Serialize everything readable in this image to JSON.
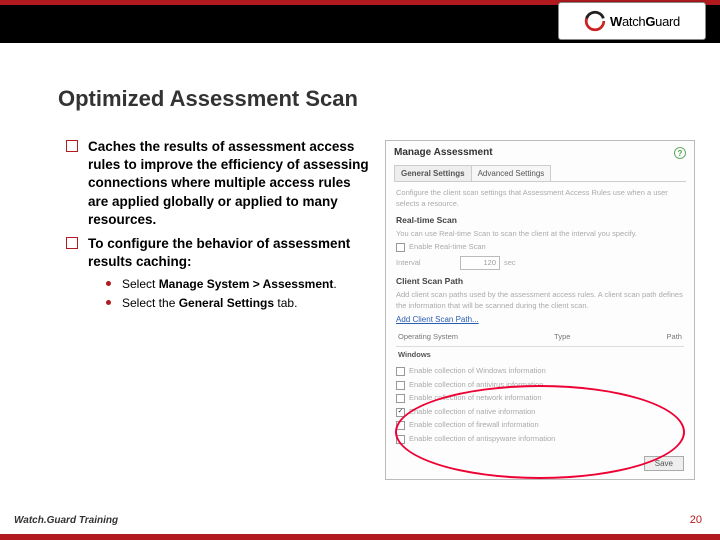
{
  "brand": {
    "name_w": "W",
    "name_atch": "atch",
    "name_g": "G",
    "name_uard": "uard"
  },
  "title": "Optimized Assessment Scan",
  "bullets": [
    "Caches the results of assessment access rules to improve the efficiency of assessing connections where multiple access rules are applied globally or applied to many resources.",
    "To configure the behavior of assessment results caching:"
  ],
  "sub": {
    "s1_pre": "Select ",
    "s1_b1": "Manage System > Assessment",
    "s1_post": ".",
    "s2_pre": "Select the ",
    "s2_b1": "General Settings",
    "s2_post": " tab."
  },
  "shot": {
    "header": "Manage Assessment",
    "tab1": "General Settings",
    "tab2": "Advanced Settings",
    "intro": "Configure the client scan settings that Assessment Access Rules use when a user selects a resource.",
    "rt_h": "Real-time Scan",
    "rt_txt": "You can use Real-time Scan to scan the client at the interval you specify.",
    "rt_cb": "Enable Real-time Scan",
    "rt_interval": "Interval",
    "rt_val": "120",
    "rt_unit": "sec",
    "csp_h": "Client Scan Path",
    "csp_txt": "Add client scan paths used by the assessment access rules. A client scan path defines the information that will be scanned during the client scan.",
    "csp_link": "Add Client Scan Path...",
    "th_os": "Operating System",
    "th_type": "Type",
    "th_path": "Path",
    "os_win": "Windows",
    "cb_win": "Enable collection of Windows information",
    "cb_av": "Enable collection of antivirus information",
    "cb_net": "Enable collection of network information",
    "cb_nav": "Enable collection of native information",
    "cb_fw": "Enable collection of firewall information",
    "cb_spy": "Enable collection of antispyware information",
    "save": "Save"
  },
  "footer": {
    "left": "Watch.Guard Training",
    "page": "20"
  }
}
